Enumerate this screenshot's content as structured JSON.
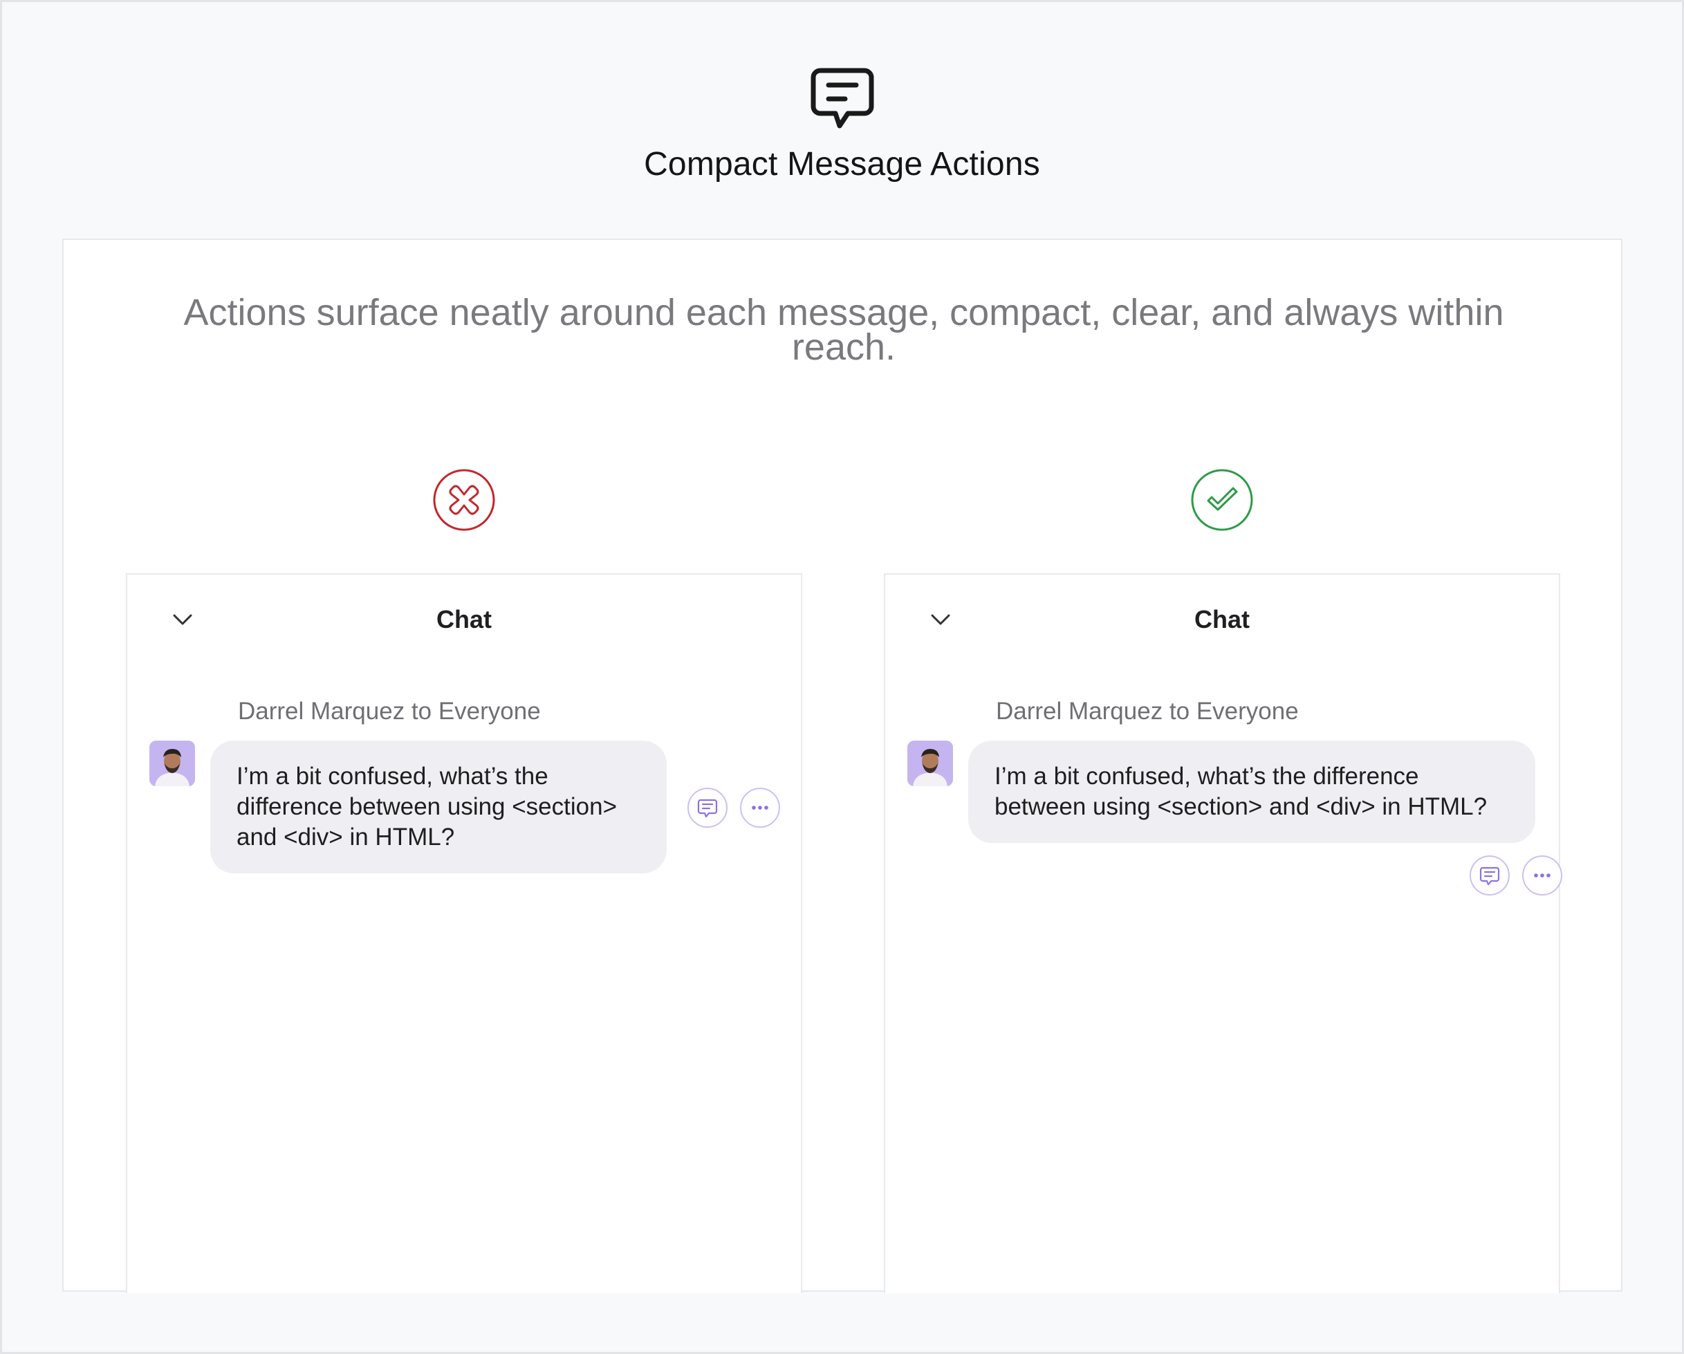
{
  "header": {
    "icon": "chat-message-icon",
    "title": "Compact Message Actions"
  },
  "description": "Actions surface neatly around each message, compact, clear, and always within reach.",
  "colors": {
    "bad": "#c0282d",
    "good": "#2e9b48",
    "action_border": "#cdbff3",
    "action_icon": "#8a72de",
    "bubble": "#efeff3"
  },
  "panels": [
    {
      "verdict": "incorrect",
      "verdict_icon": "x-circle-icon",
      "title": "Chat",
      "collapse_icon": "chevron-down-icon",
      "message": {
        "sender": "Darrel Marquez to Everyone",
        "text": "I’m a bit confused, what’s the difference between using <section> and <div> in HTML?",
        "actions": [
          "reply-icon",
          "more-icon"
        ],
        "action_placement": "beside message"
      }
    },
    {
      "verdict": "correct",
      "verdict_icon": "check-circle-icon",
      "title": "Chat",
      "collapse_icon": "chevron-down-icon",
      "message": {
        "sender": "Darrel Marquez to Everyone",
        "text": "I’m a bit confused, what’s the difference between using <section> and <div> in HTML?",
        "actions": [
          "reply-icon",
          "more-icon"
        ],
        "action_placement": "overlapping bottom edge"
      }
    }
  ]
}
